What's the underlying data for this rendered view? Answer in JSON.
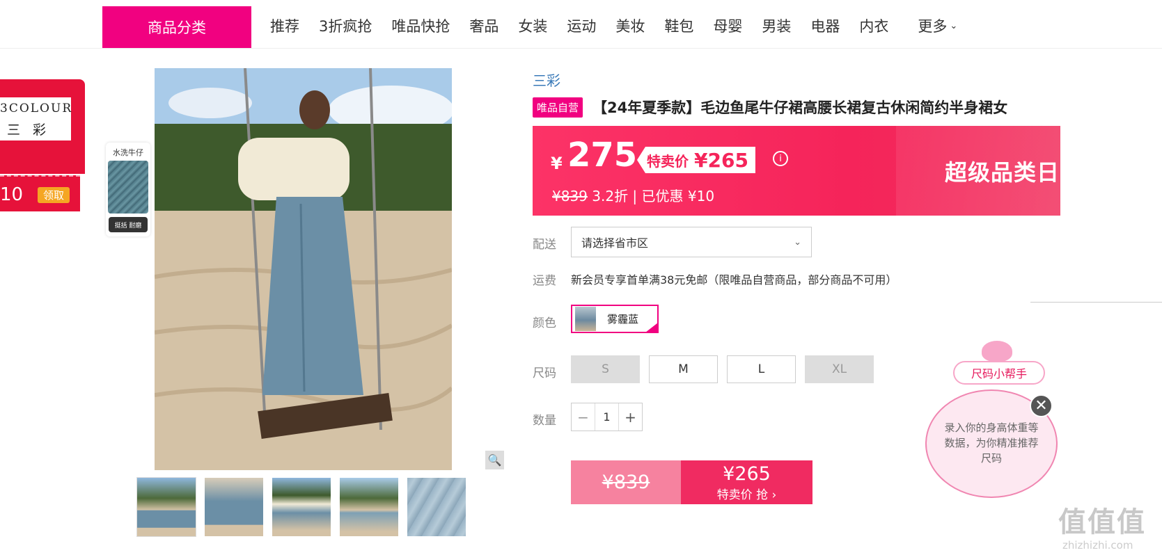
{
  "nav": {
    "category_label": "商品分类",
    "items": [
      "推荐",
      "3折疯抢",
      "唯品快抢",
      "奢品",
      "女装",
      "运动",
      "美妆",
      "鞋包",
      "母婴",
      "男装",
      "电器",
      "内衣"
    ],
    "more_label": "更多"
  },
  "store_card": {
    "logo_en": "3COLOUR",
    "logo_cn": "三 彩",
    "amount": "10",
    "claim_label": "领取"
  },
  "fabric_tag": {
    "title": "水洗牛仔",
    "badge": "挺括 耐磨"
  },
  "product": {
    "brand": "三彩",
    "badge": "唯品自营",
    "title": "【24年夏季款】毛边鱼尾牛仔裙高腰长裙复古休闲简约半身裙女"
  },
  "price": {
    "currency": "¥",
    "main": "275",
    "sale_label": "特卖价",
    "sale_price": "¥265",
    "original": "¥839",
    "discount_text": "3.2折 | 已优惠 ¥10",
    "promo_banner": "超级品类日"
  },
  "delivery": {
    "label": "配送",
    "placeholder": "请选择省市区"
  },
  "shipping": {
    "label": "运费",
    "text": "新会员专享首单满38元免邮（限唯品自营商品，部分商品不可用）"
  },
  "color": {
    "label": "颜色",
    "selected": "雾霾蓝"
  },
  "size": {
    "label": "尺码",
    "options": [
      {
        "name": "S",
        "available": false
      },
      {
        "name": "M",
        "available": true
      },
      {
        "name": "L",
        "available": true
      },
      {
        "name": "XL",
        "available": false
      }
    ]
  },
  "quantity": {
    "label": "数量",
    "value": "1",
    "minus": "−",
    "plus": "+"
  },
  "buy_button": {
    "original": "¥839",
    "price": "¥265",
    "action": "特卖价 抢 ›"
  },
  "size_helper": {
    "tag": "尺码小帮手",
    "message": "录入你的身高体重等数据，为你精准推荐尺码",
    "close": "✕"
  },
  "watermark": {
    "text": "值值值",
    "url": "zhizhizhi.com"
  },
  "colors": {
    "brand_pink": "#f10180",
    "price_red": "#f5245a",
    "brand_link": "#3a7ab8"
  }
}
